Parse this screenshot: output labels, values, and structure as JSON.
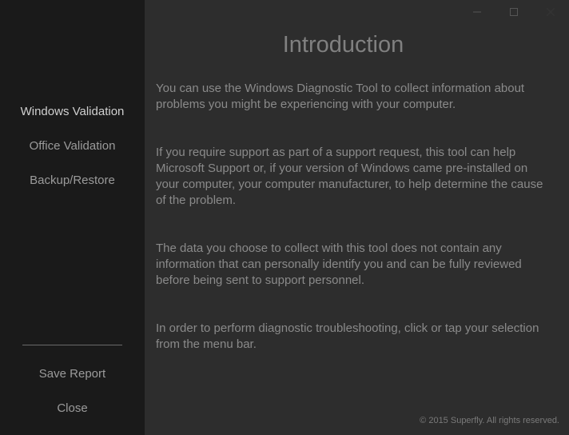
{
  "sidebar": {
    "items": [
      {
        "label": "Windows Validation"
      },
      {
        "label": "Office Validation"
      },
      {
        "label": "Backup/Restore"
      }
    ],
    "bottom": [
      {
        "label": "Save Report"
      },
      {
        "label": "Close"
      }
    ]
  },
  "page": {
    "title": "Introduction",
    "paragraphs": [
      "You can use the Windows Diagnostic Tool to collect information about problems you might be experiencing with your computer.",
      "If you require support as part of a support request, this tool can help Microsoft Support or, if your version of Windows came pre-installed on your computer, your computer manufacturer, to help determine the cause of the problem.",
      "The data you choose to collect with this tool does not contain any information that can personally identify you and can be fully reviewed before being sent to support personnel.",
      "In order to perform diagnostic troubleshooting, click or tap your selection from the menu bar."
    ]
  },
  "footer": "© 2015 Superfly. All rights reserved."
}
